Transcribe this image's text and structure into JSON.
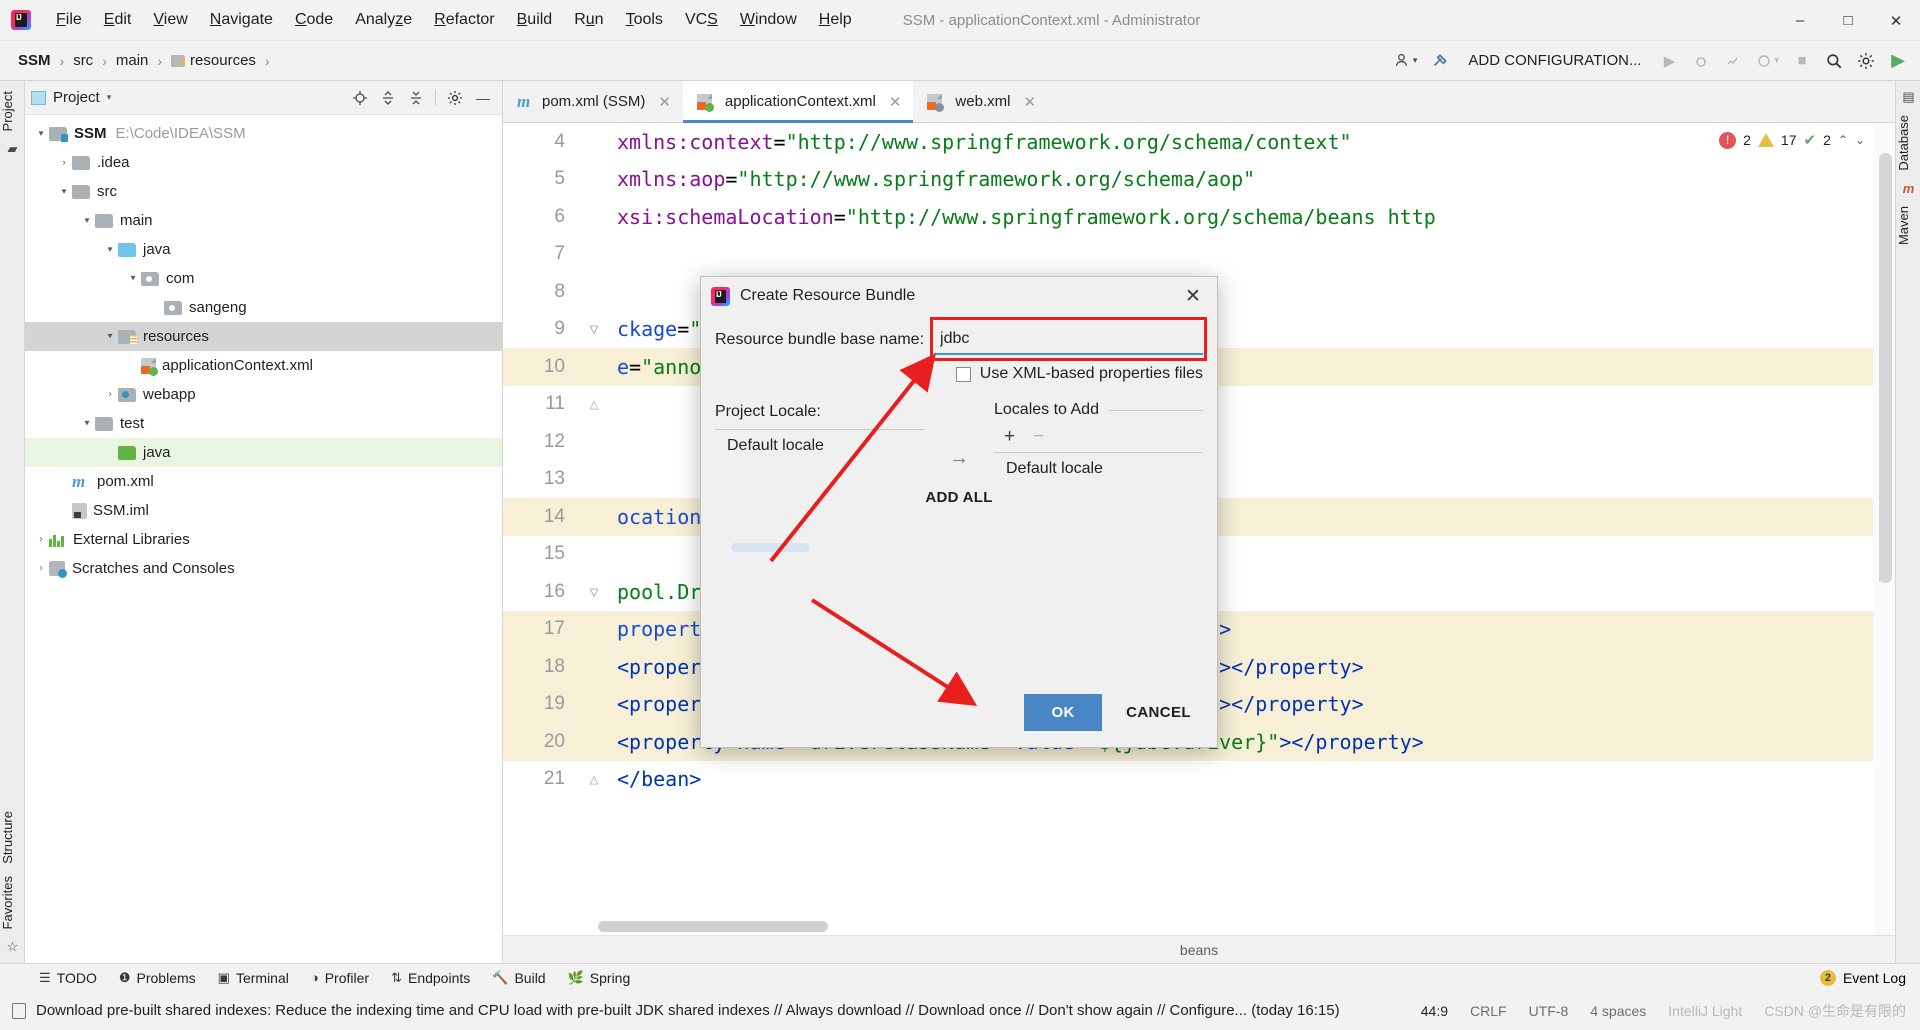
{
  "window": {
    "title": "SSM - applicationContext.xml - Administrator",
    "minimize": "–",
    "maximize": "□",
    "close": "✕"
  },
  "menu": [
    {
      "label": "File",
      "accel": "F"
    },
    {
      "label": "Edit",
      "accel": "E"
    },
    {
      "label": "View",
      "accel": "V"
    },
    {
      "label": "Navigate",
      "accel": "N"
    },
    {
      "label": "Code",
      "accel": "C"
    },
    {
      "label": "Analyze",
      "accel": "z"
    },
    {
      "label": "Refactor",
      "accel": "R"
    },
    {
      "label": "Build",
      "accel": "B"
    },
    {
      "label": "Run",
      "accel": "u"
    },
    {
      "label": "Tools",
      "accel": "T"
    },
    {
      "label": "VCS",
      "accel": "S"
    },
    {
      "label": "Window",
      "accel": "W"
    },
    {
      "label": "Help",
      "accel": "H"
    }
  ],
  "navbar": {
    "breadcrumbs": [
      "SSM",
      "src",
      "main",
      "resources"
    ],
    "separator": "›",
    "add_configuration": "ADD CONFIGURATION...",
    "icons": {
      "user": "user-icon",
      "hammer": "build-icon",
      "run": "run-icon",
      "debug": "debug-icon",
      "coverage": "coverage-icon",
      "profile": "profile-icon",
      "stop": "stop-icon",
      "search": "search-icon",
      "settings": "gear-icon"
    }
  },
  "left_strip": {
    "project": "Project",
    "structure": "Structure",
    "favorites": "Favorites"
  },
  "right_strip": {
    "database": "Database",
    "maven": "Maven"
  },
  "project_panel": {
    "title": "Project",
    "caret": "▾",
    "actions": [
      "locate-icon",
      "expand-all-icon",
      "collapse-all-icon",
      "gear-icon",
      "hide-icon"
    ],
    "tree": [
      {
        "label": "SSM",
        "path": "E:\\Code\\IDEA\\SSM",
        "depth": 0,
        "arrow": "▾",
        "icon": "module-folder",
        "bold": true,
        "state": "normal"
      },
      {
        "label": ".idea",
        "depth": 1,
        "arrow": "›",
        "icon": "folder",
        "state": "normal"
      },
      {
        "label": "src",
        "depth": 1,
        "arrow": "▾",
        "icon": "folder",
        "state": "normal"
      },
      {
        "label": "main",
        "depth": 2,
        "arrow": "▾",
        "icon": "folder",
        "state": "normal"
      },
      {
        "label": "java",
        "depth": 3,
        "arrow": "▾",
        "icon": "source-folder",
        "state": "normal"
      },
      {
        "label": "com",
        "depth": 4,
        "arrow": "▾",
        "icon": "package",
        "state": "normal"
      },
      {
        "label": "sangeng",
        "depth": 5,
        "arrow": "",
        "icon": "package",
        "state": "normal"
      },
      {
        "label": "resources",
        "depth": 3,
        "arrow": "▾",
        "icon": "resource-folder",
        "state": "selected-inactive"
      },
      {
        "label": "applicationContext.xml",
        "depth": 4,
        "arrow": "",
        "icon": "spring-xml",
        "state": "normal"
      },
      {
        "label": "webapp",
        "depth": 3,
        "arrow": "›",
        "icon": "web-folder",
        "state": "normal"
      },
      {
        "label": "test",
        "depth": 2,
        "arrow": "▾",
        "icon": "folder",
        "state": "normal"
      },
      {
        "label": "java",
        "depth": 3,
        "arrow": "",
        "icon": "test-source-folder",
        "state": "selected-green"
      },
      {
        "label": "pom.xml",
        "depth": 1,
        "arrow": "",
        "icon": "maven",
        "state": "normal"
      },
      {
        "label": "SSM.iml",
        "depth": 1,
        "arrow": "",
        "icon": "iml",
        "state": "normal"
      },
      {
        "label": "External Libraries",
        "depth": 0,
        "arrow": "›",
        "icon": "libraries",
        "state": "normal"
      },
      {
        "label": "Scratches and Consoles",
        "depth": 0,
        "arrow": "›",
        "icon": "scratches",
        "state": "normal"
      }
    ]
  },
  "editor": {
    "tabs": [
      {
        "label": "pom.xml (SSM)",
        "icon": "maven",
        "active": false,
        "close": "✕"
      },
      {
        "label": "applicationContext.xml",
        "icon": "spring-xml",
        "active": true,
        "close": "✕"
      },
      {
        "label": "web.xml",
        "icon": "web-xml",
        "active": false,
        "close": "✕"
      }
    ],
    "inspections": {
      "errors": "2",
      "warnings": "17",
      "checks": "2",
      "theme": "IntelliJ Light"
    },
    "breadcrumb_bottom": "beans",
    "lines": [
      {
        "num": "4",
        "html": "<span class=\"tok-ns\">xmlns:context</span><span class=\"tok-punct\">=</span><span class=\"tok-val\">\"http://www.springframework.org/schema/context\"</span>",
        "highlight": false,
        "fold": ""
      },
      {
        "num": "5",
        "html": "<span class=\"tok-ns\">xmlns:aop</span><span class=\"tok-punct\">=</span><span class=\"tok-val\">\"http://www.springframework.org/schema/aop\"</span>",
        "highlight": false,
        "fold": ""
      },
      {
        "num": "6",
        "html": "<span class=\"tok-ns\">xsi:schemaLocation</span><span class=\"tok-punct\">=</span><span class=\"tok-val\">\"http://www.springframework.org/schema/beans http</span>",
        "highlight": false,
        "fold": ""
      },
      {
        "num": "7",
        "html": "",
        "highlight": false,
        "fold": ""
      },
      {
        "num": "8",
        "html": "",
        "highlight": false,
        "fold": ""
      },
      {
        "num": "9",
        "html": "<span class=\"tok-attr\">ckage</span><span class=\"tok-punct\">=</span><span class=\"tok-val\">\"com.sangeng\"</span><span class=\"tok-blue\">&gt;</span>",
        "highlight": false,
        "fold": "▽"
      },
      {
        "num": "10",
        "html": "<span class=\"tok-attr\">e</span><span class=\"tok-punct\">=</span><span class=\"tok-val\">\"annotation\"</span> <span class=\"tok-attr\">expression</span><span class=\"tok-punct\">=</span><span class=\"tok-val\">\"org.springfra</span>",
        "highlight": true,
        "fold": ""
      },
      {
        "num": "11",
        "html": "",
        "highlight": false,
        "fold": "△"
      },
      {
        "num": "12",
        "html": "",
        "highlight": false,
        "fold": ""
      },
      {
        "num": "13",
        "html": "",
        "highlight": false,
        "fold": ""
      },
      {
        "num": "14",
        "html": "<span class=\"tok-attr\">ocation</span><span class=\"tok-punct\">=</span><span class=\"tok-val\">\"classpath:jdbc.properties\"</span><span class=\"tok-blue\">&gt;&lt;/</span><span class=\"tok-blue\">co</span>",
        "highlight": true,
        "fold": ""
      },
      {
        "num": "15",
        "html": "",
        "highlight": false,
        "fold": ""
      },
      {
        "num": "16",
        "html": "<span class=\"tok-val\">pool.DruidDataSource\"</span> <span class=\"tok-attr\">id</span><span class=\"tok-punct\">=</span><span class=\"tok-val\">\"dataSource\"</span><span class=\"tok-blue\">&gt;</span>",
        "highlight": false,
        "fold": "▽"
      },
      {
        "num": "17",
        "html": "<span class=\"tok-attr\">property</span> <span class=\"tok-attr\">name</span><span class=\"tok-punct\">=</span><span class=\"tok-val\">\"url\"</span> <span class=\"tok-attr\">value</span><span class=\"tok-punct\">=</span><span class=\"tok-val\">\"${jdbc.url}\"</span><span class=\"tok-blue\">&gt;&lt;/property&gt;</span>",
        "highlight": true,
        "fold": ""
      },
      {
        "num": "18",
        "html": "<span class=\"tok-blue\">&lt;property</span> <span class=\"tok-attr\">name</span><span class=\"tok-punct\">=</span><span class=\"tok-val\">\"username\"</span> <span class=\"tok-attr\">value</span><span class=\"tok-punct\">=</span><span class=\"tok-val\">\"${jdbc.username}\"</span><span class=\"tok-blue\">&gt;&lt;/property&gt;</span>",
        "highlight": true,
        "fold": ""
      },
      {
        "num": "19",
        "html": "<span class=\"tok-blue\">&lt;property</span> <span class=\"tok-attr\">name</span><span class=\"tok-punct\">=</span><span class=\"tok-val\">\"password\"</span> <span class=\"tok-attr\">value</span><span class=\"tok-punct\">=</span><span class=\"tok-val\">\"${jdbc.password}\"</span><span class=\"tok-blue\">&gt;&lt;/property&gt;</span>",
        "highlight": true,
        "fold": ""
      },
      {
        "num": "20",
        "html": "<span class=\"tok-blue\">&lt;property</span> <span class=\"tok-attr\">name</span><span class=\"tok-punct\">=</span><span class=\"tok-val\">\"driverClassName\"</span> <span class=\"tok-attr\">value</span><span class=\"tok-punct\">=</span><span class=\"tok-val\">\"${jdbc.driver}\"</span><span class=\"tok-blue\">&gt;&lt;/property&gt;</span>",
        "highlight": true,
        "fold": ""
      },
      {
        "num": "21",
        "html": "<span class=\"tok-blue\">&lt;/bean&gt;</span>",
        "highlight": false,
        "fold": "△"
      }
    ]
  },
  "dialog": {
    "title": "Create Resource Bundle",
    "close": "✕",
    "base_name_label": "Resource bundle base name:",
    "base_name_value": "jdbc",
    "base_name_placeholder": "",
    "xml_checkbox_label": "Use XML-based properties files",
    "xml_checkbox_checked": false,
    "project_locale_title": "Project Locale:",
    "project_locale_items": [
      "Default locale"
    ],
    "transfer_arrow": "→",
    "locales_to_add_title": "Locales to Add",
    "locales_add_button": "+",
    "locales_remove_button": "−",
    "locales_to_add_items": [
      "Default locale"
    ],
    "add_all_label": "ADD ALL",
    "ok_label": "OK",
    "cancel_label": "CANCEL",
    "ok_color": "#4a86c5",
    "highlight_color": "#e81f1f"
  },
  "tool_window_bar": {
    "items": [
      {
        "label": "TODO",
        "icon": "todo-icon"
      },
      {
        "label": "Problems",
        "icon": "problems-icon"
      },
      {
        "label": "Terminal",
        "icon": "terminal-icon"
      },
      {
        "label": "Profiler",
        "icon": "profiler-icon"
      },
      {
        "label": "Endpoints",
        "icon": "endpoints-icon"
      },
      {
        "label": "Build",
        "icon": "build-icon"
      },
      {
        "label": "Spring",
        "icon": "spring-icon"
      }
    ],
    "event_log": "Event Log",
    "event_count": "2"
  },
  "status_bar": {
    "message": "Download pre-built shared indexes: Reduce the indexing time and CPU load with pre-built JDK shared indexes // Always download // Download once // Don't show again // Configure... (today 16:15)",
    "caret": "44:9",
    "line_sep": "CRLF",
    "encoding": "UTF-8",
    "indent": "4 spaces",
    "branch": "IntelliJ Light",
    "watermark": "CSDN @生命是有限的"
  }
}
